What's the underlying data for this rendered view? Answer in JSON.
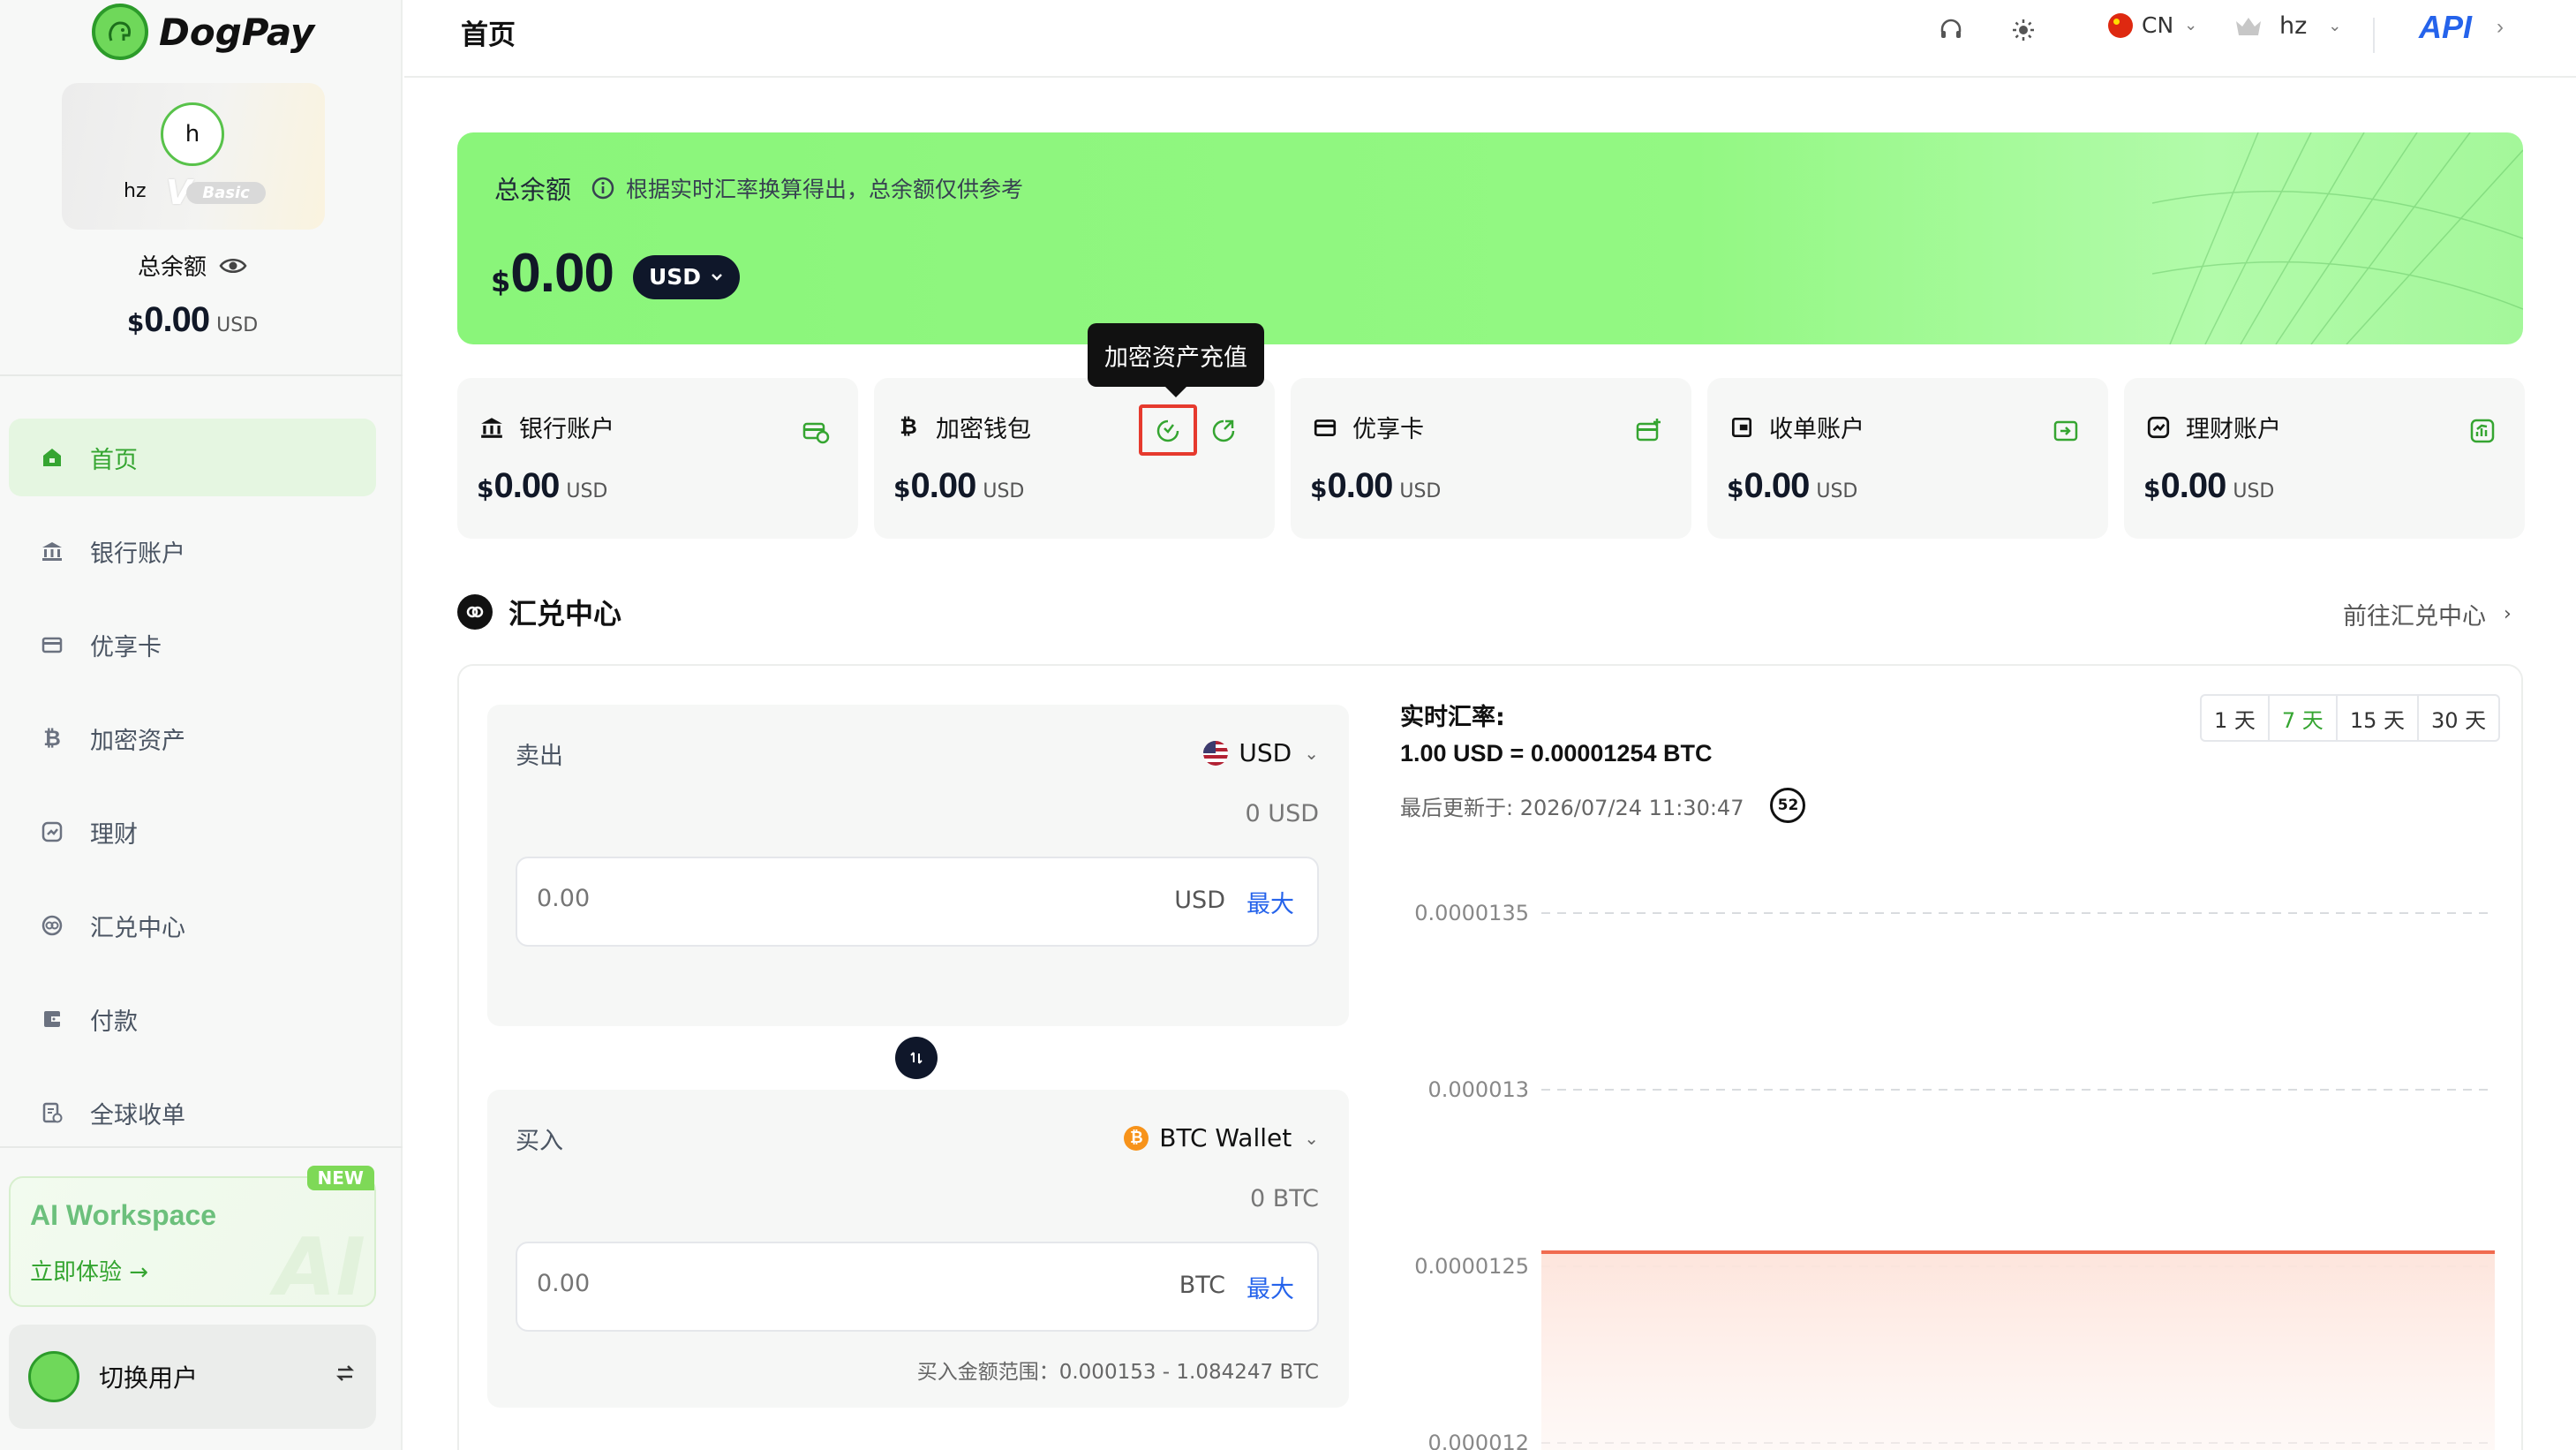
{
  "brand": {
    "name": "DogPay"
  },
  "sidebar": {
    "user": {
      "avatar_letter": "h",
      "username": "hz",
      "level": "Basic",
      "level_mark": "V"
    },
    "balance_label": "总余额",
    "balance": {
      "currency_symbol": "$",
      "amount": "0.00",
      "unit": "USD"
    },
    "nav": [
      {
        "label": "首页",
        "icon": "home-icon",
        "active": true
      },
      {
        "label": "银行账户",
        "icon": "bank-icon"
      },
      {
        "label": "优享卡",
        "icon": "card-icon"
      },
      {
        "label": "加密资产",
        "icon": "bitcoin-icon"
      },
      {
        "label": "理财",
        "icon": "finance-icon"
      },
      {
        "label": "汇兑中心",
        "icon": "exchange-icon"
      },
      {
        "label": "付款",
        "icon": "wallet-icon"
      },
      {
        "label": "全球收单",
        "icon": "receipt-icon"
      }
    ],
    "ai": {
      "badge": "NEW",
      "title": "AI Workspace",
      "cta": "立即体验 →",
      "watermark": "AI"
    },
    "switch_user": "切换用户"
  },
  "header": {
    "title": "首页",
    "language": "CN",
    "user": "hz",
    "api_label": "API"
  },
  "banner": {
    "title": "总余额",
    "hint": "根据实时汇率换算得出，总余额仅供参考",
    "currency_symbol": "$",
    "amount": "0.00",
    "currency": "USD"
  },
  "accounts": [
    {
      "title": "银行账户",
      "icon": "bank-icon",
      "currency_symbol": "$",
      "amount": "0.00",
      "unit": "USD"
    },
    {
      "title": "加密钱包",
      "icon": "bitcoin-icon",
      "currency_symbol": "$",
      "amount": "0.00",
      "unit": "USD"
    },
    {
      "title": "优享卡",
      "icon": "card-icon",
      "currency_symbol": "$",
      "amount": "0.00",
      "unit": "USD"
    },
    {
      "title": "收单账户",
      "icon": "receipt-icon",
      "currency_symbol": "$",
      "amount": "0.00",
      "unit": "USD"
    },
    {
      "title": "理财账户",
      "icon": "finance-icon",
      "currency_symbol": "$",
      "amount": "0.00",
      "unit": "USD"
    }
  ],
  "tooltip": "加密资产充值",
  "exchange": {
    "title": "汇兑中心",
    "link": "前往汇兑中心",
    "sell": {
      "label": "卖出",
      "currency": "USD",
      "balance": "0 USD",
      "placeholder": "0.00",
      "unit": "USD",
      "max": "最大"
    },
    "buy": {
      "label": "买入",
      "currency": "BTC Wallet",
      "balance": "0 BTC",
      "placeholder": "0.00",
      "unit": "BTC",
      "max": "最大",
      "range": "买入金额范围：0.000153 - 1.084247 BTC"
    },
    "rate_title": "实时汇率:",
    "rate_value": "1.00 USD = 0.00001254 BTC",
    "updated": "最后更新于: 2026/07/24 11:30:47",
    "countdown": "52",
    "ranges": [
      "1 天",
      "7 天",
      "15 天",
      "30 天"
    ],
    "active_range": 1
  },
  "chart_data": {
    "type": "area",
    "y_ticks": [
      "0.0000135",
      "0.000013",
      "0.0000125",
      "0.000012"
    ],
    "ylim": [
      1.19e-05,
      1.36e-05
    ],
    "series": [
      {
        "values": [
          1.254e-05,
          1.254e-05,
          1.254e-05,
          1.254e-05,
          1.254e-05,
          1.254e-05,
          1.254e-05,
          1.254e-05
        ]
      }
    ],
    "line_color": "#f06b4f",
    "fill_color": "#fde8e1"
  }
}
